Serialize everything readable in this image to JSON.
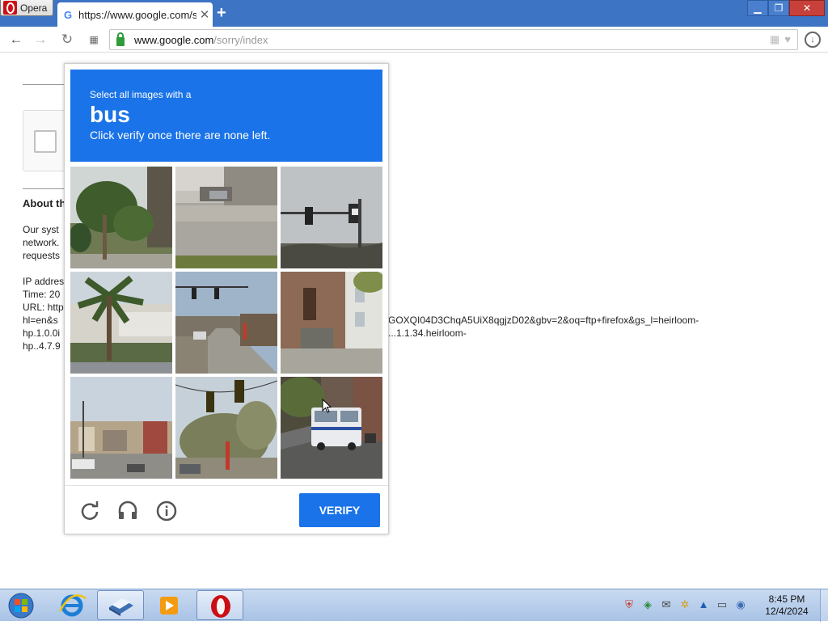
{
  "browser": {
    "menu_label": "Opera",
    "tab": {
      "title": "https://www.google.com/sorry/index",
      "favicon": "G"
    },
    "new_tab_glyph": "+",
    "address": {
      "host": "www.google.com",
      "path": "/sorry/index",
      "secure": true
    }
  },
  "page": {
    "about_heading": "About th",
    "para_lines": [
      "Our syst",
      "network.",
      "requests"
    ],
    "meta_lines": [
      "IP addres",
      "Time: 20",
      "URL: http",
      "hl=en&s",
      "hp.1.0.0i",
      "hp..4.7.9"
    ],
    "url_tail_lines": [
      "GOXQI04D3ChqA5UiX8qgjzD02&gbv=2&oq=ftp+firefox&gs_l=heirloom-",
      "...1.1.34.heirloom-"
    ]
  },
  "captcha": {
    "instruction_prefix": "Select all images with a",
    "keyword": "bus",
    "instruction_suffix": "Click verify once there are none left.",
    "tiles": [
      {
        "label": "palm-trees-street"
      },
      {
        "label": "parking-lot-cars"
      },
      {
        "label": "traffic-light-sky"
      },
      {
        "label": "palm-tree-hillside"
      },
      {
        "label": "street-traffic-lights"
      },
      {
        "label": "brick-row-houses"
      },
      {
        "label": "town-street-view"
      },
      {
        "label": "traffic-lights-trees"
      },
      {
        "label": "street-with-bus"
      }
    ],
    "verify_label": "VERIFY",
    "accent_color": "#1a73e8"
  },
  "taskbar": {
    "clock_time": "8:45 PM",
    "clock_date": "12/4/2024",
    "apps": [
      "internet-explorer",
      "library",
      "media-player",
      "opera"
    ],
    "active_app": "library"
  }
}
